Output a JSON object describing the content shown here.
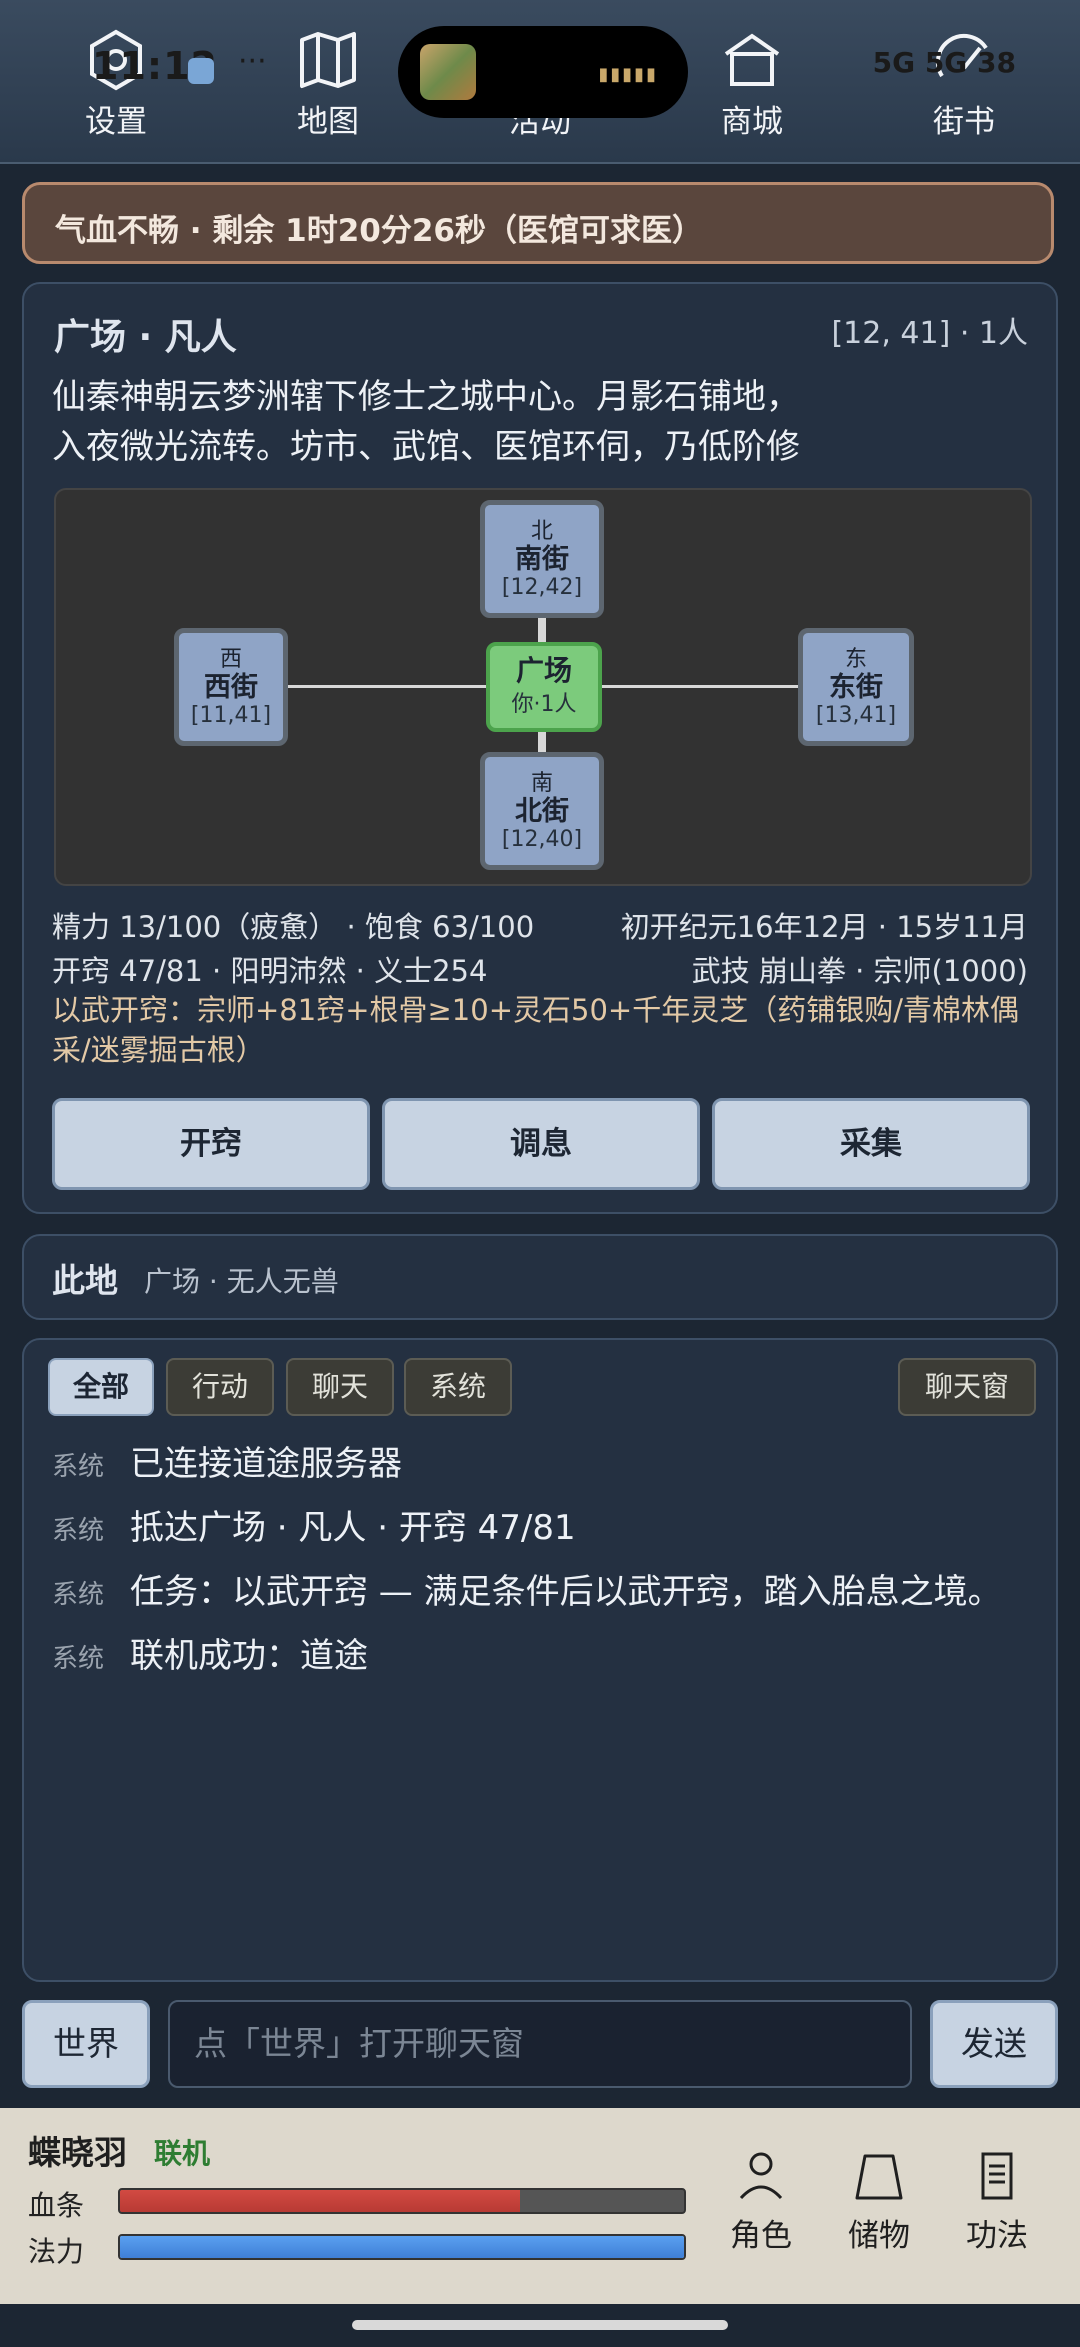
{
  "status": {
    "time": "11:12",
    "dots": "···",
    "right": "5G 5G 38"
  },
  "nav": [
    {
      "label": "设置",
      "icon": "gear-icon"
    },
    {
      "label": "地图",
      "icon": "map-icon"
    },
    {
      "label": "活动",
      "icon": "flag-icon"
    },
    {
      "label": "商城",
      "icon": "shop-icon"
    },
    {
      "label": "街书",
      "icon": "book-icon"
    }
  ],
  "banner": {
    "text": "气血不畅 · 剩余 1时20分26秒（医馆可求医）"
  },
  "location": {
    "title": "广场 · 凡人",
    "coords": "[12, 41] · 1人",
    "desc1": "仙秦神朝云梦洲辖下修士之城中心。月影石铺地，",
    "desc2": "入夜微光流转。坊市、武馆、医馆环伺，乃低阶修"
  },
  "map": {
    "north": {
      "dir": "北",
      "name": "南街",
      "coords": "[12,42]"
    },
    "west": {
      "dir": "西",
      "name": "西街",
      "coords": "[11,41]"
    },
    "center": {
      "name": "广场",
      "sub": "你·1人"
    },
    "east": {
      "dir": "东",
      "name": "东街",
      "coords": "[13,41]"
    },
    "south": {
      "dir": "南",
      "name": "北街",
      "coords": "[12,40]"
    }
  },
  "stats": {
    "energy": "精力 13/100（疲惫） · 饱食 63/100",
    "era": "初开纪元16年12月 · 15岁11月",
    "orifice": "开窍 47/81 · 阳明沛然 · 义士254",
    "skill": "武技 崩山拳 · 宗师(1000)",
    "requirement": "以武开窍：宗师+81窍+根骨≥10+灵石50+千年灵芝（药铺银购/青棉林偶采/迷雾掘古根）"
  },
  "actions": [
    "开窍",
    "调息",
    "采集"
  ],
  "here": {
    "label": "此地",
    "text": "广场 · 无人无兽"
  },
  "tabs": [
    "全部",
    "行动",
    "聊天",
    "系统"
  ],
  "chat_window_label": "聊天窗",
  "logs": [
    {
      "tag": "系统",
      "msg": "已连接道途服务器"
    },
    {
      "tag": "系统",
      "msg": "抵达广场 · 凡人 · 开窍 47/81"
    },
    {
      "tag": "系统",
      "msg": "任务：以武开窍 — 满足条件后以武开窍，踏入胎息之境。"
    },
    {
      "tag": "系统",
      "msg": "联机成功：道途"
    }
  ],
  "chat": {
    "world_label": "世界",
    "placeholder": "点「世界」打开聊天窗",
    "send_label": "发送"
  },
  "player": {
    "name": "蝶晓羽",
    "status": "联机",
    "hp_label": "血条",
    "mp_label": "法力",
    "hp_fraction": 0.71,
    "mp_fraction": 1.0
  },
  "bottom_nav": [
    {
      "label": "角色",
      "icon": "person-icon"
    },
    {
      "label": "储物",
      "icon": "bag-icon"
    },
    {
      "label": "功法",
      "icon": "scroll-icon"
    }
  ],
  "colors": {
    "accent": "#c7d3e2",
    "hp": "#d24a42",
    "mp": "#4a8fe6",
    "center_node": "#7ccb7c",
    "online": "#2e7d32"
  }
}
